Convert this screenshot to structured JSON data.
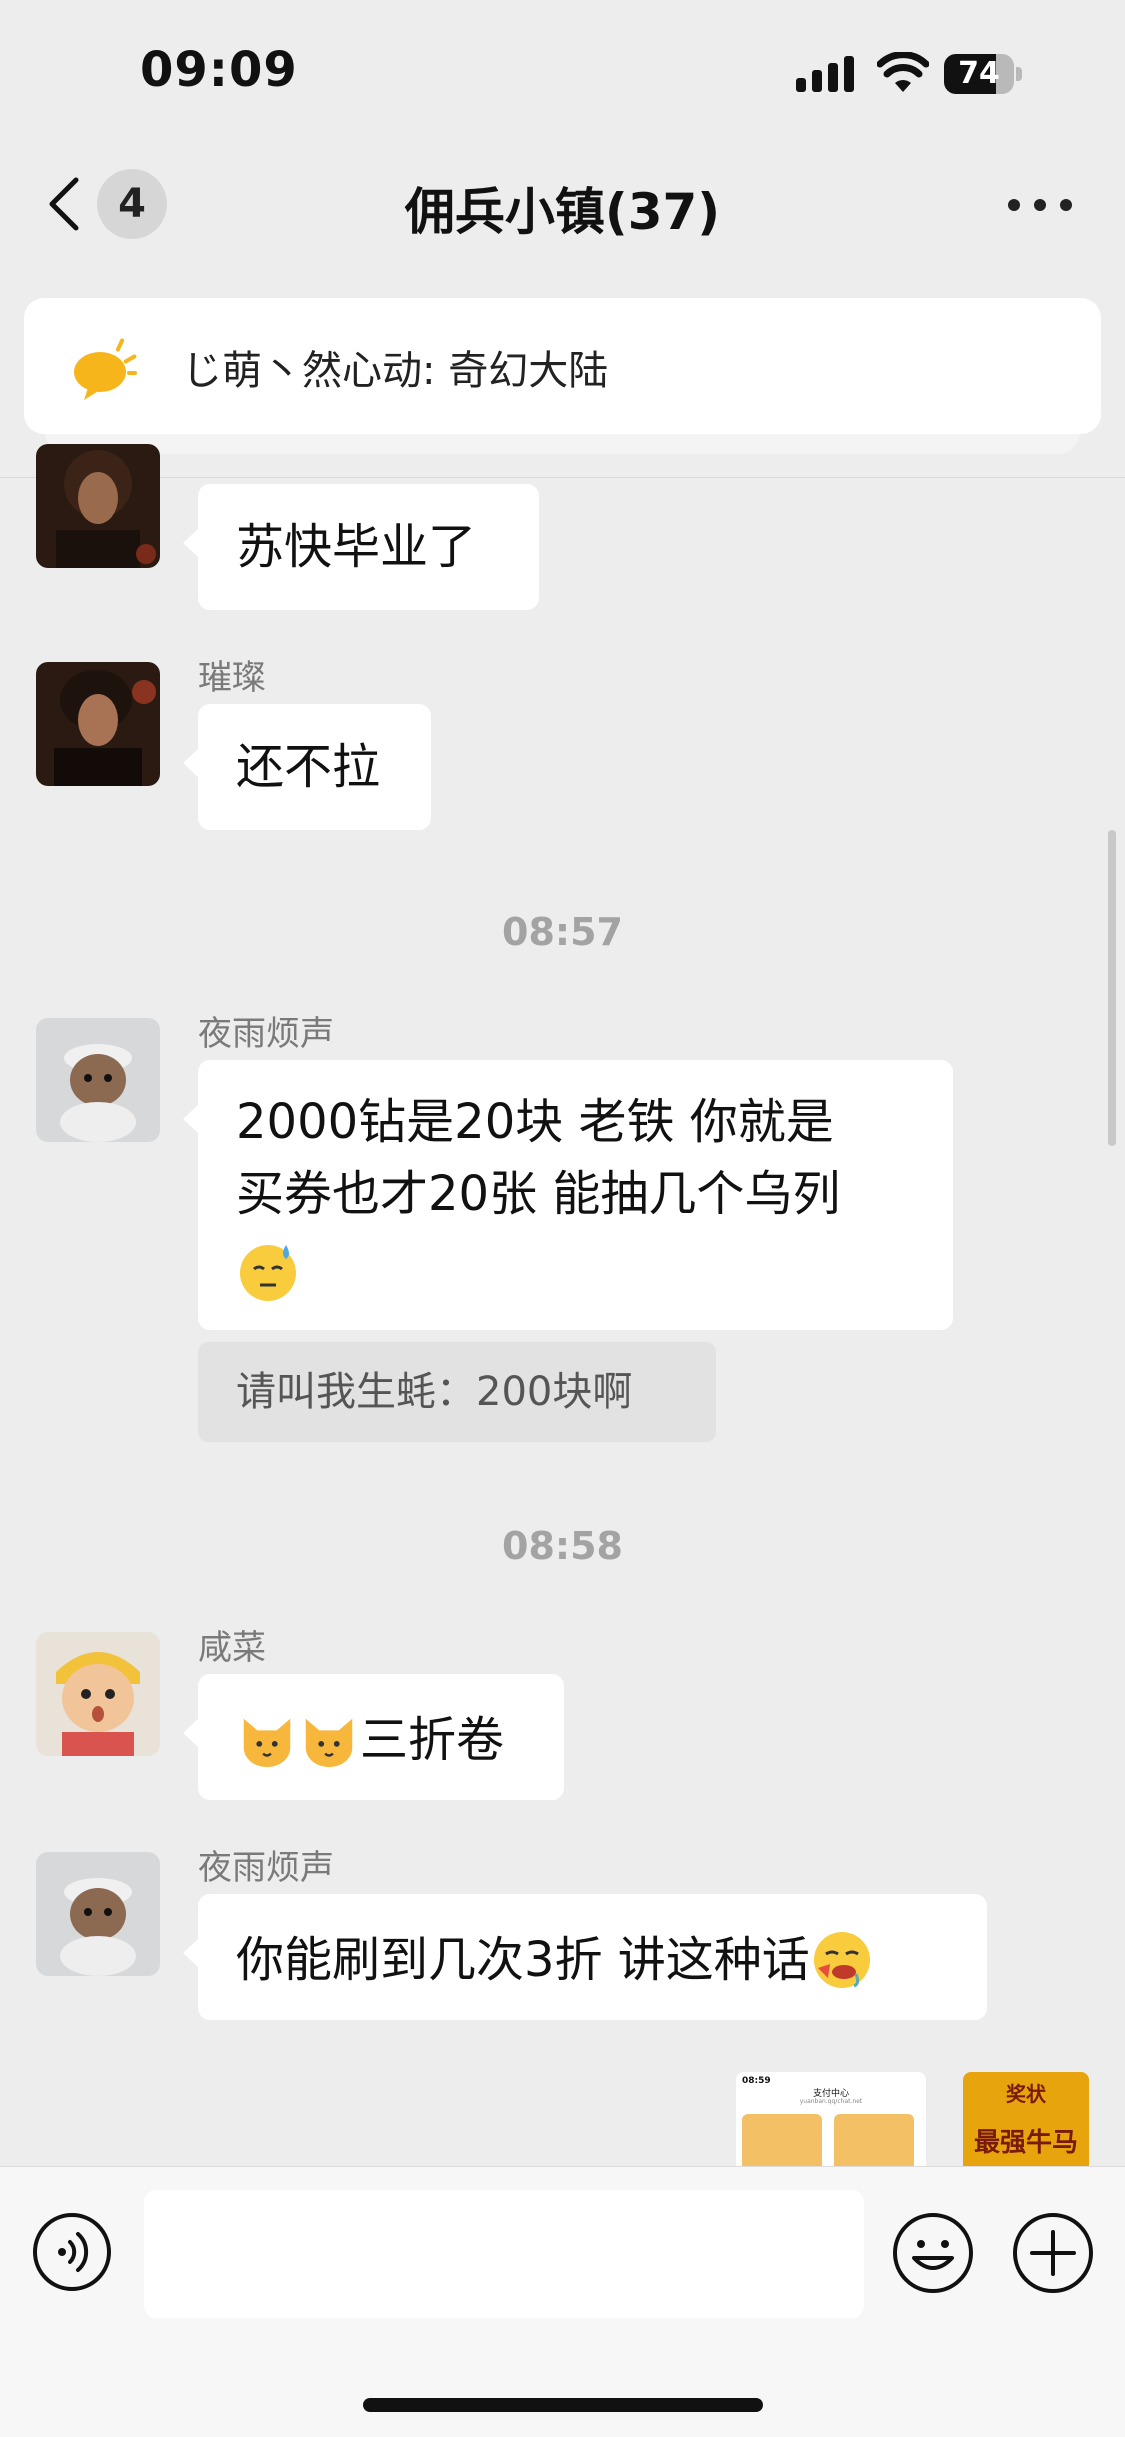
{
  "status_bar": {
    "time": "09:09",
    "battery": "74",
    "battery_level": 0.74
  },
  "nav": {
    "unread_count": "4",
    "title": "佣兵小镇(37)"
  },
  "announcement": {
    "text": "じ萌丶然心动: 奇幻大陆"
  },
  "messages": [
    {
      "sender": "",
      "text": "苏快毕业了"
    },
    {
      "sender": "璀璨",
      "text": "还不拉"
    },
    {
      "type": "time",
      "text": "08:57"
    },
    {
      "sender": "夜雨烦声",
      "text_line1": "2000钻是20块 老铁 你就是",
      "text_line2": "买券也才20张 能抽几个乌列",
      "quote": "请叫我生蚝：200块啊"
    },
    {
      "type": "time",
      "text": "08:58"
    },
    {
      "sender": "咸菜",
      "text": "三折卷"
    },
    {
      "sender": "夜雨烦声",
      "text": "你能刷到几次3折 讲这种话"
    }
  ],
  "thumbnails": {
    "screenshot": {
      "time": "08:59",
      "title": "支付中心",
      "subtitle": "yuanban.qq/chat.net"
    },
    "sticker": {
      "text_top": "奖状",
      "text_main": "最强牛马"
    }
  },
  "icons": [
    "back-icon",
    "more-icon",
    "voice-icon",
    "emoji-icon",
    "add-icon",
    "announcement-speaker-icon",
    "cold-sweat-emoji",
    "cat-emoji",
    "drooling-emoji"
  ]
}
